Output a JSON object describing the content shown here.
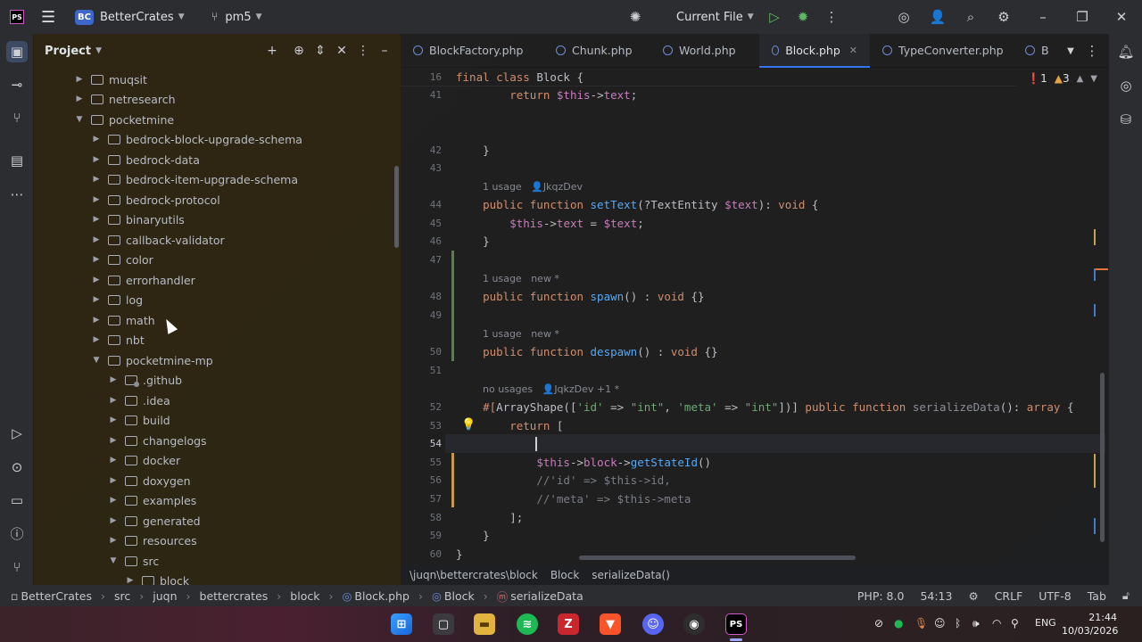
{
  "titlebar": {
    "project_badge": "BC",
    "project_name": "BetterCrates",
    "vcs_branch": "pm5",
    "run_config": "Current File"
  },
  "project_panel": {
    "title": "Project",
    "tree": [
      {
        "label": "muqsit",
        "depth": 0,
        "expanded": false
      },
      {
        "label": "netresearch",
        "depth": 0,
        "expanded": false
      },
      {
        "label": "pocketmine",
        "depth": 0,
        "expanded": true
      },
      {
        "label": "bedrock-block-upgrade-schema",
        "depth": 1,
        "expanded": false
      },
      {
        "label": "bedrock-data",
        "depth": 1,
        "expanded": false
      },
      {
        "label": "bedrock-item-upgrade-schema",
        "depth": 1,
        "expanded": false
      },
      {
        "label": "bedrock-protocol",
        "depth": 1,
        "expanded": false
      },
      {
        "label": "binaryutils",
        "depth": 1,
        "expanded": false
      },
      {
        "label": "callback-validator",
        "depth": 1,
        "expanded": false
      },
      {
        "label": "color",
        "depth": 1,
        "expanded": false
      },
      {
        "label": "errorhandler",
        "depth": 1,
        "expanded": false
      },
      {
        "label": "log",
        "depth": 1,
        "expanded": false
      },
      {
        "label": "math",
        "depth": 1,
        "expanded": false
      },
      {
        "label": "nbt",
        "depth": 1,
        "expanded": false
      },
      {
        "label": "pocketmine-mp",
        "depth": 1,
        "expanded": true
      },
      {
        "label": ".github",
        "depth": 2,
        "expanded": false,
        "git": true
      },
      {
        "label": ".idea",
        "depth": 2,
        "expanded": false
      },
      {
        "label": "build",
        "depth": 2,
        "expanded": false
      },
      {
        "label": "changelogs",
        "depth": 2,
        "expanded": false
      },
      {
        "label": "docker",
        "depth": 2,
        "expanded": false
      },
      {
        "label": "doxygen",
        "depth": 2,
        "expanded": false
      },
      {
        "label": "examples",
        "depth": 2,
        "expanded": false
      },
      {
        "label": "generated",
        "depth": 2,
        "expanded": false
      },
      {
        "label": "resources",
        "depth": 2,
        "expanded": false
      },
      {
        "label": "src",
        "depth": 2,
        "expanded": true
      },
      {
        "label": "block",
        "depth": 3,
        "expanded": false
      }
    ]
  },
  "editor": {
    "tabs": [
      {
        "label": "BlockFactory.php",
        "active": false
      },
      {
        "label": "Chunk.php",
        "active": false
      },
      {
        "label": "World.php",
        "active": false
      },
      {
        "label": "Block.php",
        "active": true
      },
      {
        "label": "TypeConverter.php",
        "active": false
      },
      {
        "label": "B",
        "active": false
      }
    ],
    "inspections": {
      "errors": "1",
      "warnings": "3"
    },
    "sticky_line": {
      "num": "16",
      "text": "final class Block {"
    },
    "lines": [
      {
        "num": "41"
      },
      {
        "num": "42"
      },
      {
        "num": "43"
      },
      {
        "num": "44"
      },
      {
        "num": "45"
      },
      {
        "num": "46"
      },
      {
        "num": "47"
      },
      {
        "num": "48"
      },
      {
        "num": "49"
      },
      {
        "num": "50"
      },
      {
        "num": "51"
      },
      {
        "num": "52"
      },
      {
        "num": "53"
      },
      {
        "num": "54"
      },
      {
        "num": "55"
      },
      {
        "num": "56"
      },
      {
        "num": "57"
      },
      {
        "num": "58"
      },
      {
        "num": "59"
      },
      {
        "num": "60"
      }
    ],
    "hints": {
      "setText": {
        "usages": "1 usage",
        "author": "JkqzDev"
      },
      "spawn": {
        "usages": "1 usage",
        "author": "new *"
      },
      "despawn": {
        "usages": "1 usage",
        "author": "new *"
      },
      "serialize": {
        "usages": "no usages",
        "author": "JqkzDev +1 *"
      }
    },
    "breadcrumb": [
      "\\juqn\\bettercrates\\block",
      "Block",
      "serializeData()"
    ]
  },
  "statusbar": {
    "crumbs": [
      "BetterCrates",
      "src",
      "juqn",
      "bettercrates",
      "block",
      "Block.php",
      "Block",
      "serializeData"
    ],
    "php": "PHP: 8.0",
    "position": "54:13",
    "line_sep": "CRLF",
    "encoding": "UTF-8",
    "indent": "Tab"
  },
  "taskbar": {
    "lang": "ENG",
    "time": "21:44",
    "date": "10/03/2026"
  }
}
